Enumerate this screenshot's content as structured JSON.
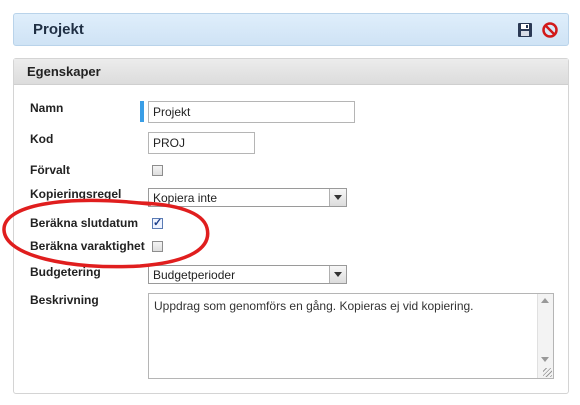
{
  "header": {
    "title": "Projekt",
    "save_icon": "save-icon",
    "cancel_icon": "cancel-icon"
  },
  "panel": {
    "title": "Egenskaper",
    "fields": {
      "name": {
        "label": "Namn",
        "value": "Projekt"
      },
      "code": {
        "label": "Kod",
        "value": "PROJ"
      },
      "default": {
        "label": "Förvalt",
        "checked": false
      },
      "copy_rule": {
        "label": "Kopieringsregel",
        "value": "Kopiera inte"
      },
      "calc_end_date": {
        "label": "Beräkna slutdatum",
        "checked": true
      },
      "calc_duration": {
        "label": "Beräkna varaktighet",
        "checked": false
      },
      "budgeting": {
        "label": "Budgetering",
        "value": "Budgetperioder"
      },
      "description": {
        "label": "Beskrivning",
        "value": "Uppdrag som genomförs en gång. Kopieras ej vid kopiering."
      }
    }
  },
  "colors": {
    "accent": "#3a9ee6",
    "annotation": "#e01e1e"
  }
}
